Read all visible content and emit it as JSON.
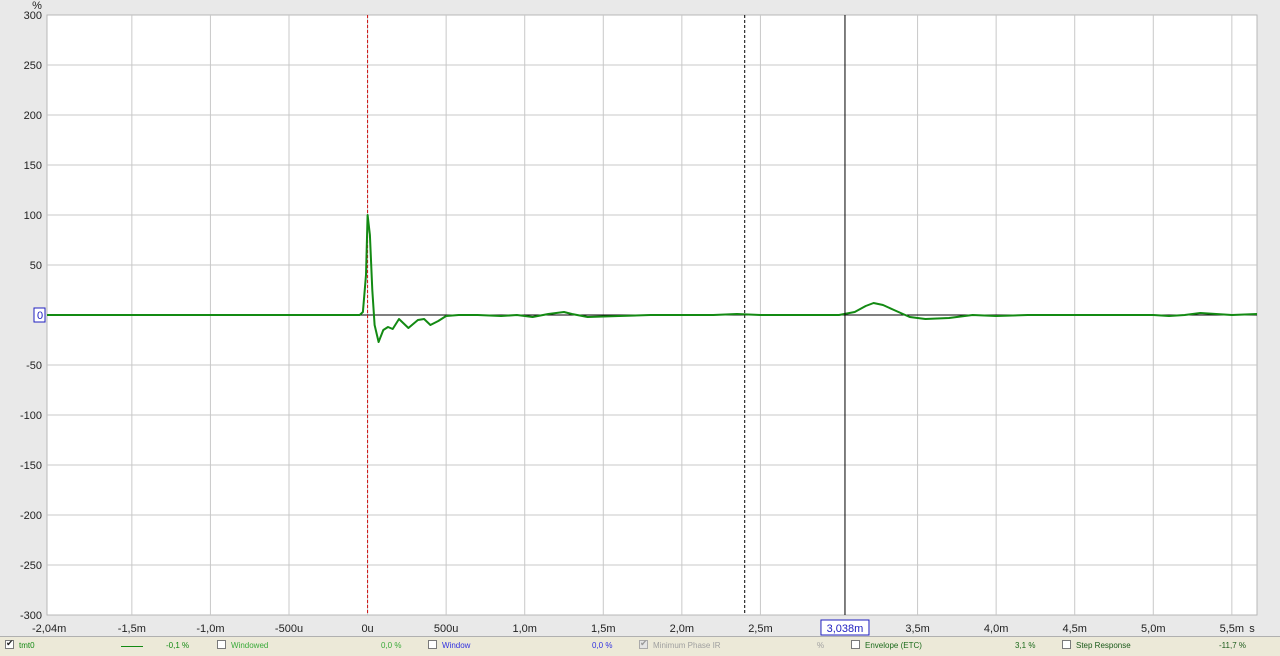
{
  "chart_data": {
    "type": "line",
    "ylabel": "%",
    "ylim": [
      -300,
      300
    ],
    "yticks": [
      300,
      250,
      200,
      150,
      100,
      50,
      0,
      -50,
      -100,
      -150,
      -200,
      -250,
      -300
    ],
    "xlim": [
      -2.04,
      5.66
    ],
    "xunit": "ms",
    "xticks": [
      {
        "value": -2.04,
        "label": "-2,04m"
      },
      {
        "value": -1.5,
        "label": "-1,5m"
      },
      {
        "value": -1.0,
        "label": "-1,0m"
      },
      {
        "value": -0.5,
        "label": "-500u"
      },
      {
        "value": 0.0,
        "label": "0u"
      },
      {
        "value": 0.5,
        "label": "500u"
      },
      {
        "value": 1.0,
        "label": "1,0m"
      },
      {
        "value": 1.5,
        "label": "1,5m"
      },
      {
        "value": 2.0,
        "label": "2,0m"
      },
      {
        "value": 2.5,
        "label": "2,5m"
      },
      {
        "value": 3.5,
        "label": "3,5m"
      },
      {
        "value": 4.0,
        "label": "4,0m"
      },
      {
        "value": 4.5,
        "label": "4,5m"
      },
      {
        "value": 5.0,
        "label": "5,0m"
      },
      {
        "value": 5.5,
        "label": "5,5m"
      }
    ],
    "xunit_label": "s",
    "grid": true,
    "cursor": {
      "x": 3.038,
      "label": "3,038m"
    },
    "zero_label": "0",
    "markers": [
      {
        "x": 0.0,
        "style": "dashed",
        "color": "#d01010"
      },
      {
        "x": 2.4,
        "style": "dashed",
        "color": "#000000"
      }
    ],
    "series": [
      {
        "name": "tmt0",
        "color": "#138a13",
        "points": [
          [
            -2.04,
            0
          ],
          [
            -0.05,
            0
          ],
          [
            -0.03,
            3
          ],
          [
            -0.01,
            40
          ],
          [
            0.0,
            100
          ],
          [
            0.015,
            80
          ],
          [
            0.03,
            25
          ],
          [
            0.045,
            -10
          ],
          [
            0.07,
            -27
          ],
          [
            0.1,
            -15
          ],
          [
            0.13,
            -12
          ],
          [
            0.16,
            -14
          ],
          [
            0.2,
            -4
          ],
          [
            0.26,
            -13
          ],
          [
            0.32,
            -5
          ],
          [
            0.36,
            -4
          ],
          [
            0.4,
            -10
          ],
          [
            0.45,
            -6
          ],
          [
            0.5,
            -1
          ],
          [
            0.58,
            0
          ],
          [
            0.7,
            0
          ],
          [
            0.85,
            -1
          ],
          [
            0.95,
            0
          ],
          [
            1.05,
            -2
          ],
          [
            1.15,
            1
          ],
          [
            1.25,
            3
          ],
          [
            1.3,
            1
          ],
          [
            1.4,
            -2
          ],
          [
            1.6,
            -1
          ],
          [
            1.8,
            0
          ],
          [
            2.0,
            0
          ],
          [
            2.2,
            0
          ],
          [
            2.35,
            1
          ],
          [
            2.5,
            0
          ],
          [
            2.8,
            0
          ],
          [
            3.0,
            0
          ],
          [
            3.1,
            3
          ],
          [
            3.17,
            9
          ],
          [
            3.22,
            12
          ],
          [
            3.28,
            10
          ],
          [
            3.35,
            5
          ],
          [
            3.45,
            -2
          ],
          [
            3.55,
            -4
          ],
          [
            3.7,
            -3
          ],
          [
            3.85,
            0
          ],
          [
            4.0,
            -1
          ],
          [
            4.2,
            0
          ],
          [
            4.4,
            0
          ],
          [
            4.6,
            0
          ],
          [
            4.8,
            0
          ],
          [
            5.0,
            0
          ],
          [
            5.1,
            -1
          ],
          [
            5.2,
            0
          ],
          [
            5.3,
            2
          ],
          [
            5.4,
            1
          ],
          [
            5.5,
            0
          ],
          [
            5.66,
            1
          ]
        ]
      }
    ]
  },
  "legend": {
    "trace_name": "tmt0",
    "trace_value": "-0,1 %",
    "windowed_label": "Windowed",
    "windowed_value": "0,0 %",
    "window_label": "Window",
    "window_value": "0,0 %",
    "minphase_label": "Minimum Phase IR",
    "minphase_value": "%",
    "envelope_label": "Envelope (ETC)",
    "envelope_value": "3,1 %",
    "step_label": "Step Response",
    "step_value": "-11,7 %",
    "colors": {
      "trace": "#138a13",
      "windowed": "#3aaa3a",
      "window": "#3030e0",
      "disabled": "#a0a0a0",
      "envelope": "#1a6a1a",
      "step": "#1a5a1a"
    }
  }
}
